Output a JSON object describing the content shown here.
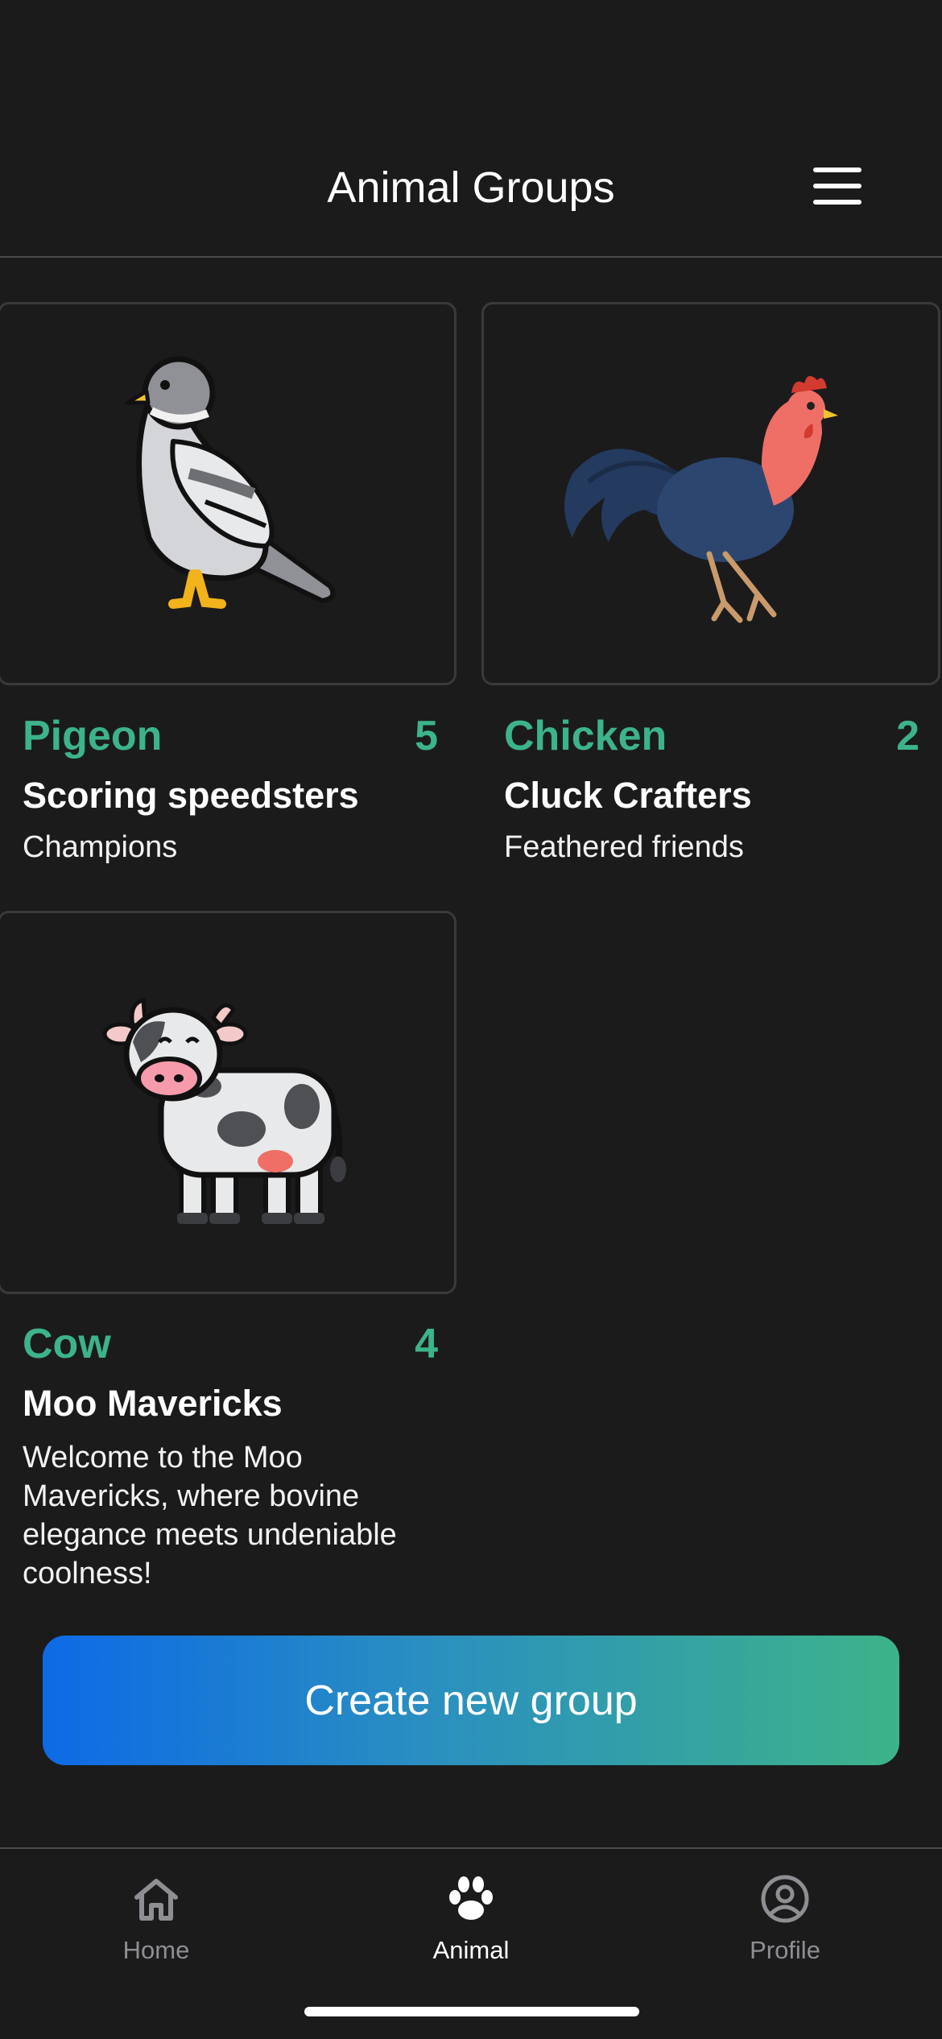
{
  "header": {
    "title": "Animal Groups",
    "menu_icon": "hamburger-menu-icon"
  },
  "groups": [
    {
      "animal": "Pigeon",
      "count": "5",
      "name": "Scoring speedsters",
      "description": "Champions",
      "icon": "pigeon-illustration"
    },
    {
      "animal": "Chicken",
      "count": "2",
      "name": "Cluck Crafters",
      "description": "Feathered friends",
      "icon": "rooster-illustration"
    },
    {
      "animal": "Cow",
      "count": "4",
      "name": "Moo Mavericks",
      "description": "Welcome to the Moo Mavericks, where bovine elegance meets undeniable coolness!",
      "icon": "cow-illustration"
    }
  ],
  "create_button": {
    "label": "Create new group"
  },
  "tabbar": {
    "tabs": [
      {
        "label": "Home",
        "icon": "home-icon",
        "active": false
      },
      {
        "label": "Animal",
        "icon": "paw-icon",
        "active": true
      },
      {
        "label": "Profile",
        "icon": "profile-icon",
        "active": false
      }
    ]
  },
  "colors": {
    "background": "#1b1b1c",
    "accent": "#3db389",
    "button_gradient_start": "#0d6ae6",
    "button_gradient_end": "#3db389"
  }
}
